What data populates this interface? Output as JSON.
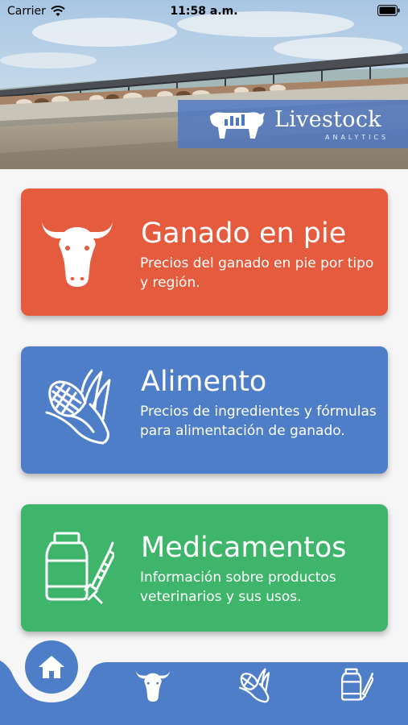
{
  "status_bar": {
    "carrier": "Carrier",
    "time": "11:58 a.m."
  },
  "header": {
    "logo_name": "Livestock",
    "logo_sub": "ANALYTICS"
  },
  "cards": [
    {
      "title": "Ganado en pie",
      "description": "Precios del ganado en pie por tipo y región.",
      "icon": "cow-head-icon",
      "color": "#e45b3e"
    },
    {
      "title": "Alimento",
      "description": "Precios de ingredientes y fórmulas para alimentación de ganado.",
      "icon": "corn-icon",
      "color": "#4f7ec8"
    },
    {
      "title": "Medicamentos",
      "description": "Información sobre productos veterinarios y sus usos.",
      "icon": "medicine-icon",
      "color": "#3fb56c"
    }
  ],
  "nav": {
    "items": [
      "home-icon",
      "cow-head-icon",
      "corn-icon",
      "medicine-icon"
    ],
    "accent": "#4f7ec8"
  }
}
